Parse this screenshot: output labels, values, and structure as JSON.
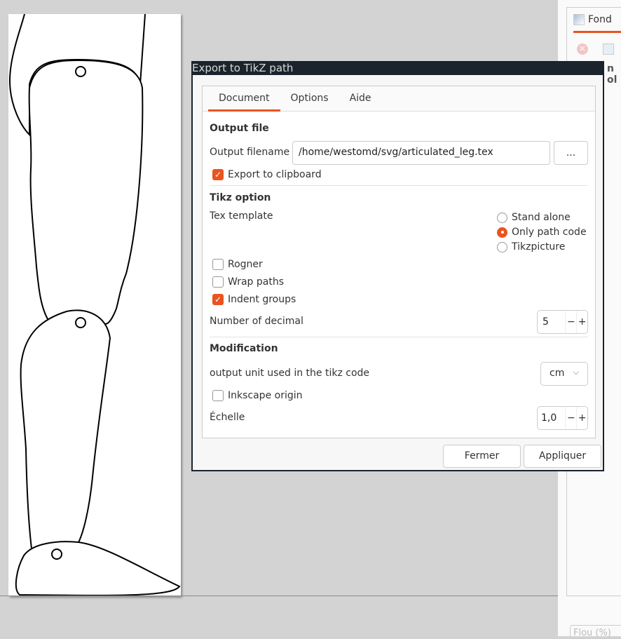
{
  "dialog": {
    "title": "Export to TikZ path",
    "tabs": [
      {
        "label": "Document",
        "active": true
      },
      {
        "label": "Options"
      },
      {
        "label": "Aide"
      }
    ],
    "output_file": {
      "heading": "Output file",
      "filename_label": "Output filename",
      "filename_value": "/home/westomd/svg/articulated_leg.tex",
      "browse_label": "...",
      "export_clipboard_label": "Export to clipboard",
      "export_clipboard_checked": true
    },
    "tikz_option": {
      "heading": "Tikz option",
      "tex_template_label": "Tex template",
      "tex_template_options": [
        {
          "label": "Stand alone",
          "selected": false
        },
        {
          "label": "Only path code",
          "selected": true
        },
        {
          "label": "Tikzpicture",
          "selected": false
        }
      ],
      "rogner_label": "Rogner",
      "rogner_checked": false,
      "wrap_label": "Wrap paths",
      "wrap_checked": false,
      "indent_label": "Indent groups",
      "indent_checked": true,
      "decimal_label": "Number of decimal",
      "decimal_value": "5"
    },
    "modification": {
      "heading": "Modification",
      "unit_label": "output unit used in the tikz code",
      "unit_value": "cm",
      "origin_label": "Inkscape origin",
      "origin_checked": false,
      "scale_label": "Échelle",
      "scale_value": "1,0"
    },
    "buttons": {
      "close": "Fermer",
      "apply": "Appliquer"
    },
    "spin_minus": "−",
    "spin_plus": "+",
    "check_mark": "✓",
    "chevron": "⌵"
  },
  "right_panel": {
    "tab_label": "Fond",
    "partial_heading": "n ol",
    "blur_field": "Flou (%)"
  },
  "colors": {
    "accent": "#e95420",
    "titlebar": "#1b242c"
  }
}
